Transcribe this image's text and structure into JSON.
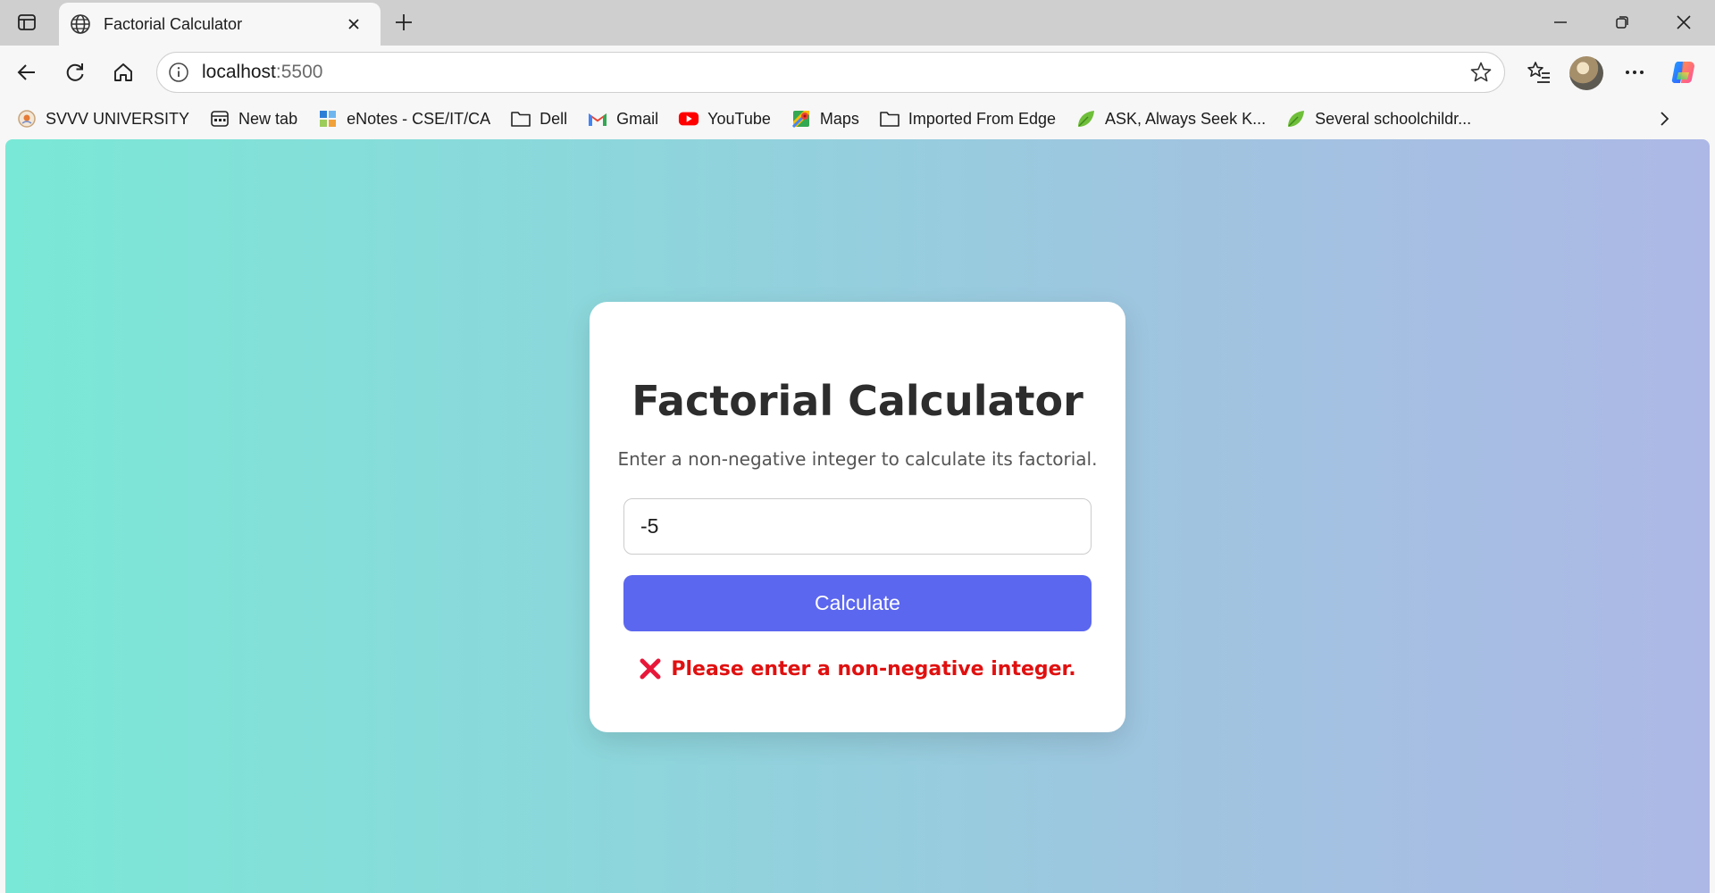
{
  "browser": {
    "tab_title": "Factorial Calculator",
    "url_host": "localhost",
    "url_port": ":5500"
  },
  "bookmarks": [
    {
      "label": "SVVV UNIVERSITY",
      "icon": "university-logo-icon"
    },
    {
      "label": "New tab",
      "icon": "new-tab-icon"
    },
    {
      "label": "eNotes - CSE/IT/CA",
      "icon": "enotes-icon"
    },
    {
      "label": "Dell",
      "icon": "folder-icon"
    },
    {
      "label": "Gmail",
      "icon": "gmail-icon"
    },
    {
      "label": "YouTube",
      "icon": "youtube-icon"
    },
    {
      "label": "Maps",
      "icon": "maps-icon"
    },
    {
      "label": "Imported From Edge",
      "icon": "folder-icon"
    },
    {
      "label": "ASK, Always Seek K...",
      "icon": "leaf-icon"
    },
    {
      "label": "Several schoolchildr...",
      "icon": "leaf-icon"
    }
  ],
  "page": {
    "title": "Factorial Calculator",
    "description": "Enter a non-negative integer to calculate its factorial.",
    "input_value": "-5",
    "button_label": "Calculate",
    "error_message": "Please enter a non-negative integer."
  },
  "colors": {
    "accent": "#5c67ef",
    "error": "#e01010"
  }
}
